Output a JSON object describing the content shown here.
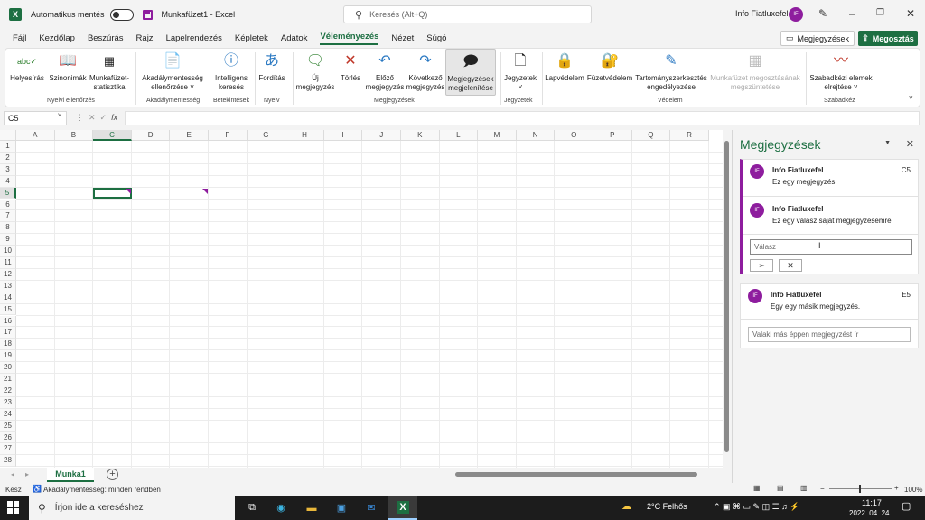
{
  "titlebar": {
    "autosave_label": "Automatikus mentés",
    "doc_title": "Munkafüzet1 - Excel",
    "search_placeholder": "Keresés (Alt+Q)",
    "user_name": "Info Fiatluxefel",
    "user_initials": "IF"
  },
  "menu": {
    "tabs": [
      "Fájl",
      "Kezdőlap",
      "Beszúrás",
      "Rajz",
      "Lapelrendezés",
      "Képletek",
      "Adatok",
      "Véleményezés",
      "Nézet",
      "Súgó"
    ],
    "active": "Véleményezés",
    "comments_button": "Megjegyzések",
    "share_button": "Megosztás"
  },
  "ribbon": {
    "spelling": "Helyesírás",
    "thesaurus": "Szinonimák",
    "wb_stats_1": "Munkafüzet-",
    "wb_stats_2": "statisztika",
    "group_proofing": "Nyelvi ellenőrzés",
    "accessibility_1": "Akadálymentesség",
    "accessibility_2": "ellenőrzése ˅",
    "group_accessibility": "Akadálymentesség",
    "smart_lookup_1": "Intelligens",
    "smart_lookup_2": "keresés",
    "group_insights": "Betekintések",
    "translate": "Fordítás",
    "group_language": "Nyelv",
    "new_comment_1": "Új",
    "new_comment_2": "megjegyzés",
    "delete": "Törlés",
    "prev_1": "Előző",
    "prev_2": "megjegyzés",
    "next_1": "Következő",
    "next_2": "megjegyzés",
    "show_1": "Megjegyzések",
    "show_2": "megjelenítése",
    "group_comments": "Megjegyzések",
    "notes_1": "Jegyzetek",
    "notes_2": "˅",
    "group_notes": "Jegyzetek",
    "protect_sheet": "Lapvédelem",
    "protect_wb": "Füzetvédelem",
    "allow_ranges_1": "Tartományszerkesztés",
    "allow_ranges_2": "engedélyezése",
    "unshare_1": "Munkafüzet megosztásának",
    "unshare_2": "megszüntetése",
    "group_protect": "Védelem",
    "hide_ink_1": "Szabadkézi elemek",
    "hide_ink_2": "elrejtése ˅",
    "group_ink": "Szabadkéz"
  },
  "formula": {
    "name_box": "C5",
    "fx": "fx"
  },
  "grid": {
    "columns": [
      "A",
      "B",
      "C",
      "D",
      "E",
      "F",
      "G",
      "H",
      "I",
      "J",
      "K",
      "L",
      "M",
      "N",
      "O",
      "P",
      "Q",
      "R"
    ],
    "rows": [
      "1",
      "2",
      "3",
      "4",
      "5",
      "6",
      "7",
      "8",
      "9",
      "10",
      "11",
      "12",
      "13",
      "14",
      "15",
      "16",
      "17",
      "18",
      "19",
      "20",
      "21",
      "22",
      "23",
      "24",
      "25",
      "26",
      "27",
      "28"
    ],
    "selected_cell": "C5"
  },
  "sheets": {
    "active": "Munka1",
    "add": "+"
  },
  "status": {
    "ready": "Kész",
    "accessibility": "Akadálymentesség: minden rendben",
    "zoom": "100%"
  },
  "comments_pane": {
    "title": "Megjegyzések",
    "thread1": {
      "author": "Info Fiatluxefel",
      "ref": "C5",
      "text": "Ez egy megjegyzés.",
      "reply_author": "Info Fiatluxefel",
      "reply_text": "Ez egy válasz saját megjegyzésemre",
      "reply_placeholder": "Válasz"
    },
    "thread2": {
      "author": "Info Fiatluxefel",
      "ref": "E5",
      "text": "Egy egy másik megjegyzés.",
      "busy_placeholder": "Valaki más éppen megjegyzést ír"
    }
  },
  "taskbar": {
    "search_placeholder": "Írjon ide a kereséshez",
    "weather": "2°C  Felhős",
    "time": "11:17",
    "date": "2022. 04. 24."
  },
  "colors": {
    "excel_green": "#1d6f42",
    "comment_purple": "#8e1d9e"
  }
}
